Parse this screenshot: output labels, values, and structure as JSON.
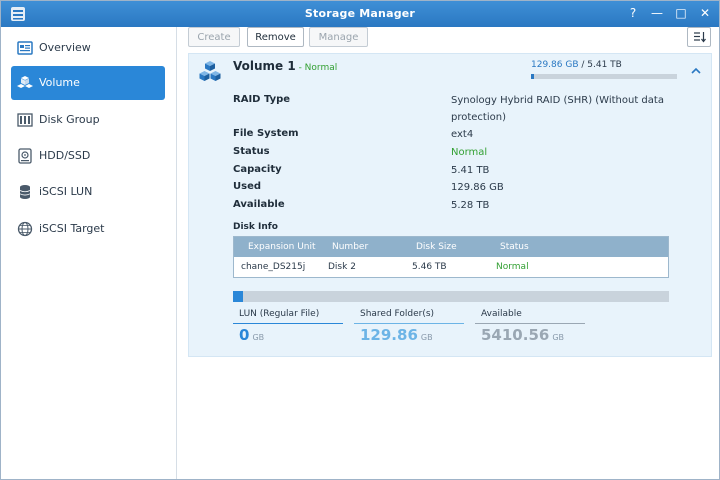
{
  "window": {
    "title": "Storage Manager",
    "controls": [
      "?",
      "—",
      "□",
      "✕"
    ]
  },
  "colors": {
    "accent": "#2a87d8",
    "ok": "#33a033",
    "header": "#8fb1cb"
  },
  "sidebar": {
    "items": [
      {
        "label": "Overview",
        "icon": "overview-icon",
        "active": false
      },
      {
        "label": "Volume",
        "icon": "volume-icon",
        "active": true
      },
      {
        "label": "Disk Group",
        "icon": "disk-group-icon",
        "active": false
      },
      {
        "label": "HDD/SSD",
        "icon": "hdd-icon",
        "active": false
      },
      {
        "label": "iSCSI LUN",
        "icon": "iscsi-lun-icon",
        "active": false
      },
      {
        "label": "iSCSI Target",
        "icon": "iscsi-target-icon",
        "active": false
      }
    ]
  },
  "toolbar": {
    "create": "Create",
    "remove": "Remove",
    "manage": "Manage",
    "sort_icon": "sort-icon"
  },
  "volume": {
    "name": "Volume 1",
    "status": " - Normal",
    "used": "129.86 GB",
    "separator": " / ",
    "total": "5.41 TB",
    "usage_fraction": 0.023,
    "properties": [
      {
        "label": "RAID Type",
        "value": "Synology Hybrid RAID (SHR) (Without data protection)"
      },
      {
        "label": "File System",
        "value": "ext4"
      },
      {
        "label": "Status",
        "value": "Normal"
      },
      {
        "label": "Capacity",
        "value": "5.41 TB"
      },
      {
        "label": "Used",
        "value": "129.86 GB"
      },
      {
        "label": "Available",
        "value": "5.28 TB"
      }
    ],
    "disk_info": {
      "title": "Disk Info",
      "headers": [
        "Expansion Unit",
        "Number",
        "Disk Size",
        "Status"
      ],
      "rows": [
        {
          "unit": "chane_DS215j",
          "number": "Disk 2",
          "size": "5.46 TB",
          "status": "Normal"
        }
      ]
    },
    "allocation_fraction": 0.024,
    "stats": [
      {
        "label": "LUN (Regular File)",
        "value": "0",
        "unit": "GB"
      },
      {
        "label": "Shared Folder(s)",
        "value": "129.86",
        "unit": "GB"
      },
      {
        "label": "Available",
        "value": "5410.56",
        "unit": "GB"
      }
    ]
  }
}
